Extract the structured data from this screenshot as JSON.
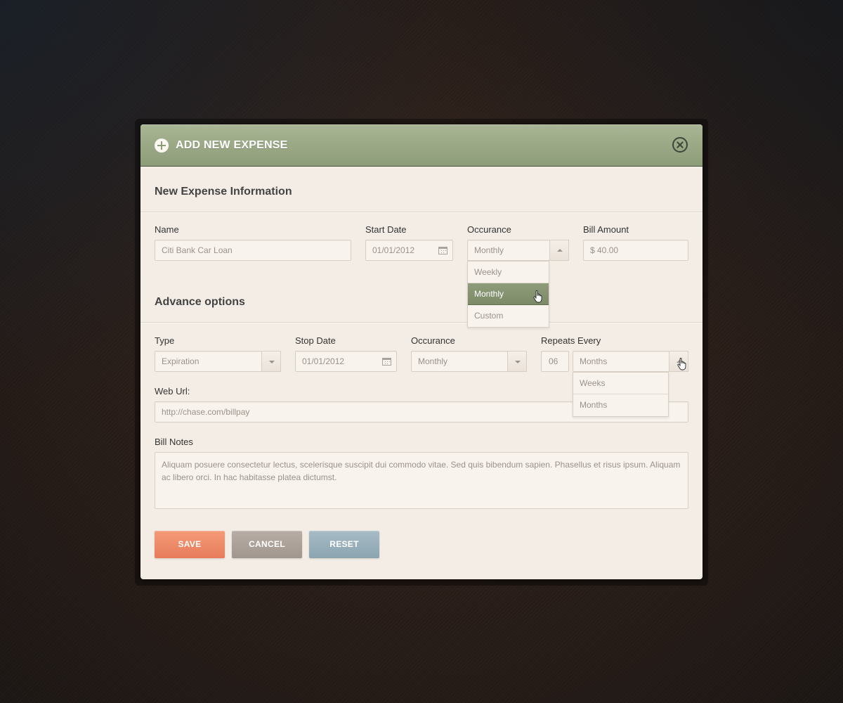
{
  "dialog": {
    "title": "ADD NEW EXPENSE"
  },
  "expense_info": {
    "section_title": "New Expense Information",
    "name": {
      "label": "Name",
      "value": "Citi Bank Car Loan"
    },
    "start_date": {
      "label": "Start Date",
      "value": "01/01/2012"
    },
    "occurance": {
      "label": "Occurance",
      "value": "Monthly",
      "options": [
        "Weekly",
        "Monthly",
        "Custom"
      ],
      "highlighted": "Monthly"
    },
    "bill_amount": {
      "label": "Bill Amount",
      "value": "$ 40.00"
    }
  },
  "advance_options": {
    "section_title": "Advance options",
    "type": {
      "label": "Type",
      "value": "Expiration"
    },
    "stop_date": {
      "label": "Stop Date",
      "value": "01/01/2012"
    },
    "occurance": {
      "label": "Occurance",
      "value": "Monthly"
    },
    "repeats_every": {
      "label": "Repeats Every",
      "count": "06",
      "unit": "Months",
      "options": [
        "Weeks",
        "Months"
      ]
    },
    "web_url": {
      "label": "Web Url:",
      "value": "http://chase.com/billpay"
    },
    "bill_notes": {
      "label": "Bill Notes",
      "value": "Aliquam posuere consectetur lectus, scelerisque suscipit dui commodo vitae. Sed quis bibendum sapien. Phasellus et risus ipsum. Aliquam ac libero orci. In hac habitasse platea dictumst."
    }
  },
  "actions": {
    "save": "SAVE",
    "cancel": "CANCEL",
    "reset": "RESET"
  },
  "colors": {
    "header": "#9aa886",
    "save": "#ef8c6a",
    "cancel": "#aea39a",
    "reset": "#9ab0bb",
    "selected_option": "#86936f"
  }
}
